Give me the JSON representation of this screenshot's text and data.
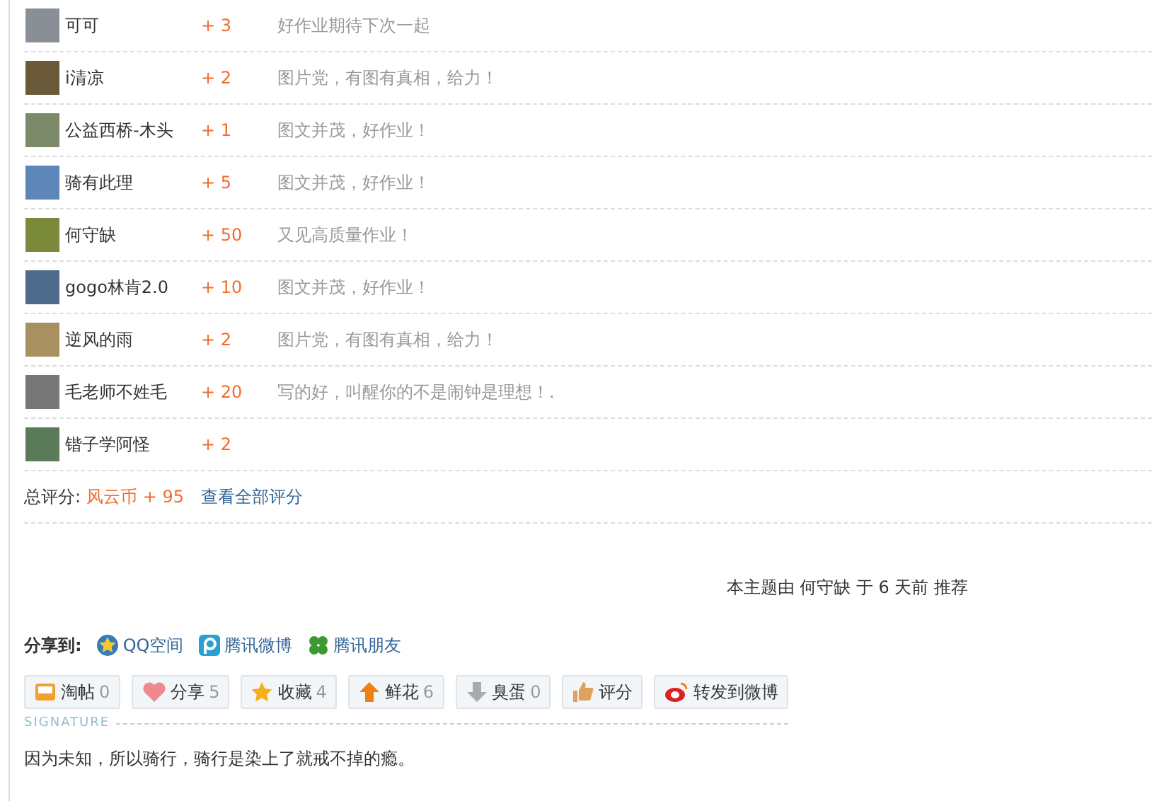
{
  "ratings": [
    {
      "user": "可可",
      "score": "+ 3",
      "comment": "好作业期待下次一起"
    },
    {
      "user": "i清凉",
      "score": "+ 2",
      "comment": "图片党，有图有真相，给力！"
    },
    {
      "user": "公益西桥-木头",
      "score": "+ 1",
      "comment": "图文并茂，好作业！"
    },
    {
      "user": "骑有此理",
      "score": "+ 5",
      "comment": "图文并茂，好作业！"
    },
    {
      "user": "何守缺",
      "score": "+ 50",
      "comment": "又见高质量作业！"
    },
    {
      "user": "gogo林肯2.0",
      "score": "+ 10",
      "comment": "图文并茂，好作业！"
    },
    {
      "user": "逆风的雨",
      "score": "+ 2",
      "comment": "图片党，有图有真相，给力！"
    },
    {
      "user": "毛老师不姓毛",
      "score": "+ 20",
      "comment": "写的好，叫醒你的不是闹钟是理想！."
    },
    {
      "user": "锴子学阿怪",
      "score": "+ 2"
    }
  ],
  "total": {
    "label": "总评分:",
    "value": "风云币 + 95",
    "link": "查看全部评分"
  },
  "recommend": "本主题由 何守缺 于 6 天前 推荐",
  "share": {
    "label": "分享到:",
    "targets": [
      {
        "kind": "qzone",
        "label": "QQ空间"
      },
      {
        "kind": "tweibo",
        "label": "腾讯微博"
      },
      {
        "kind": "pengyou",
        "label": "腾讯朋友"
      }
    ]
  },
  "actions": [
    {
      "kind": "tray",
      "label": "淘帖",
      "count": "0"
    },
    {
      "kind": "heart",
      "label": "分享",
      "count": "5"
    },
    {
      "kind": "star",
      "label": "收藏",
      "count": "4"
    },
    {
      "kind": "up",
      "label": "鲜花",
      "count": "6"
    },
    {
      "kind": "down",
      "label": "臭蛋",
      "count": "0"
    },
    {
      "kind": "thumb",
      "label": "评分"
    },
    {
      "kind": "weibo",
      "label": "转发到微博"
    }
  ],
  "signature": {
    "heading": "SIGNATURE",
    "text": "因为未知，所以骑行，骑行是染上了就戒不掉的瘾。"
  }
}
